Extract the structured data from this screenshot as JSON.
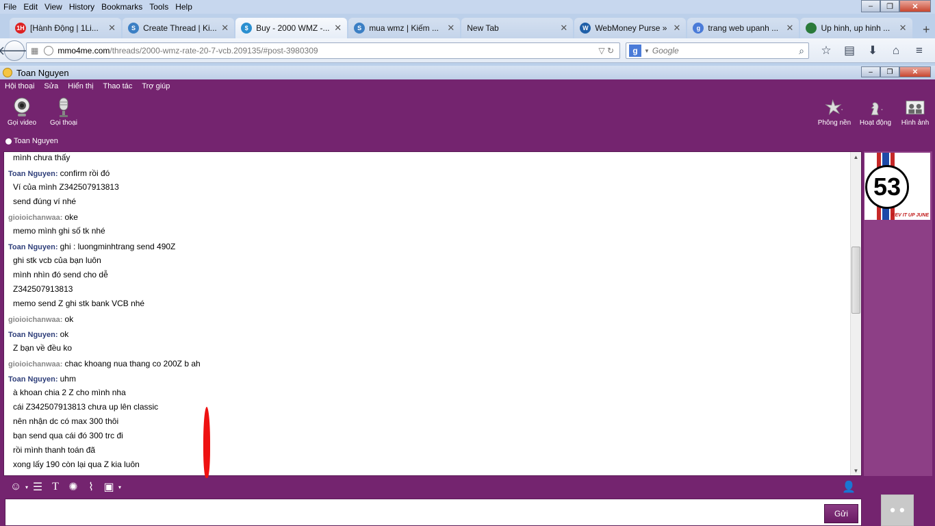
{
  "browser": {
    "menu": [
      "File",
      "Edit",
      "View",
      "History",
      "Bookmarks",
      "Tools",
      "Help"
    ],
    "tabs": [
      {
        "title": "[Hành Động | 1Li...",
        "fav_color": "#d22",
        "fav_text": "1H",
        "active": false
      },
      {
        "title": "Create Thread | Ki...",
        "fav_color": "#3b7fc4",
        "fav_text": "S",
        "active": false
      },
      {
        "title": "Buy - 2000 WMZ -...",
        "fav_color": "#2a8fd0",
        "fav_text": "$",
        "active": true
      },
      {
        "title": "mua wmz | Kiếm ...",
        "fav_color": "#3b7fc4",
        "fav_text": "S",
        "active": false
      },
      {
        "title": "New Tab",
        "fav_color": "",
        "fav_text": "",
        "active": false
      },
      {
        "title": "WebMoney Purse »",
        "fav_color": "#1f5fa8",
        "fav_text": "W",
        "active": false
      },
      {
        "title": "trang web upanh ...",
        "fav_color": "#4a7bd8",
        "fav_text": "g",
        "active": false
      },
      {
        "title": "Up hinh, up hinh ...",
        "fav_color": "#2a7a3a",
        "fav_text": "",
        "active": false
      }
    ],
    "url_host": "mmo4me.com",
    "url_path": "/threads/2000-wmz-rate-20-7-vcb.209135/#post-3980309",
    "search_placeholder": "Google"
  },
  "messenger": {
    "window_title": "Toan Nguyen",
    "menu": [
      "Hội thoại",
      "Sửa",
      "Hiển thị",
      "Thao tác",
      "Trợ giúp"
    ],
    "toolbar_left": [
      {
        "label": "Gọi video",
        "icon": "webcam-icon"
      },
      {
        "label": "Gọi thoại",
        "icon": "microphone-icon"
      }
    ],
    "toolbar_right": [
      {
        "label": "Phông nền",
        "icon": "background-icon"
      },
      {
        "label": "Hoạt động",
        "icon": "activity-icon"
      },
      {
        "label": "Hình ảnh",
        "icon": "photos-icon"
      }
    ],
    "presence_name": "Toan Nguyen",
    "avatar_number": "53",
    "avatar_caption": "REV IT UP JUNE",
    "send_label": "Gửi",
    "messages": [
      {
        "sender": "",
        "lines": [
          "mình chưa thấy"
        ]
      },
      {
        "sender": "Toan Nguyen",
        "self": true,
        "lines": [
          "confirm rồi đó",
          "Ví của mình Z342507913813",
          "send đúng ví nhé"
        ]
      },
      {
        "sender": "gioioichanwaa",
        "self": false,
        "lines": [
          "oke",
          "memo mình ghi số tk nhé"
        ]
      },
      {
        "sender": "Toan Nguyen",
        "self": true,
        "lines": [
          "ghi : luongminhtrang send 490Z",
          "ghi stk vcb của bạn luôn",
          "mình nhìn đó send cho dễ",
          "Z342507913813",
          "memo send Z ghi stk bank VCB nhé"
        ]
      },
      {
        "sender": "gioioichanwaa",
        "self": false,
        "lines": [
          "ok"
        ]
      },
      {
        "sender": "Toan Nguyen",
        "self": true,
        "lines": [
          "ok",
          "Z bạn về đều ko"
        ]
      },
      {
        "sender": "gioioichanwaa",
        "self": false,
        "lines": [
          "chac khoang nua thang co 200Z b ah"
        ]
      },
      {
        "sender": "Toan Nguyen",
        "self": true,
        "lines": [
          "uhm",
          "à khoan chia 2 Z cho mình nha",
          "cái Z342507913813 chưa up lên classic",
          "nên nhận dc có max 300 thôi",
          "bạn send qua cái đó 300 trc đi",
          "rồi mình thanh toán đã",
          "xong lấy 190 còn lại qua Z kia luôn"
        ]
      }
    ]
  }
}
